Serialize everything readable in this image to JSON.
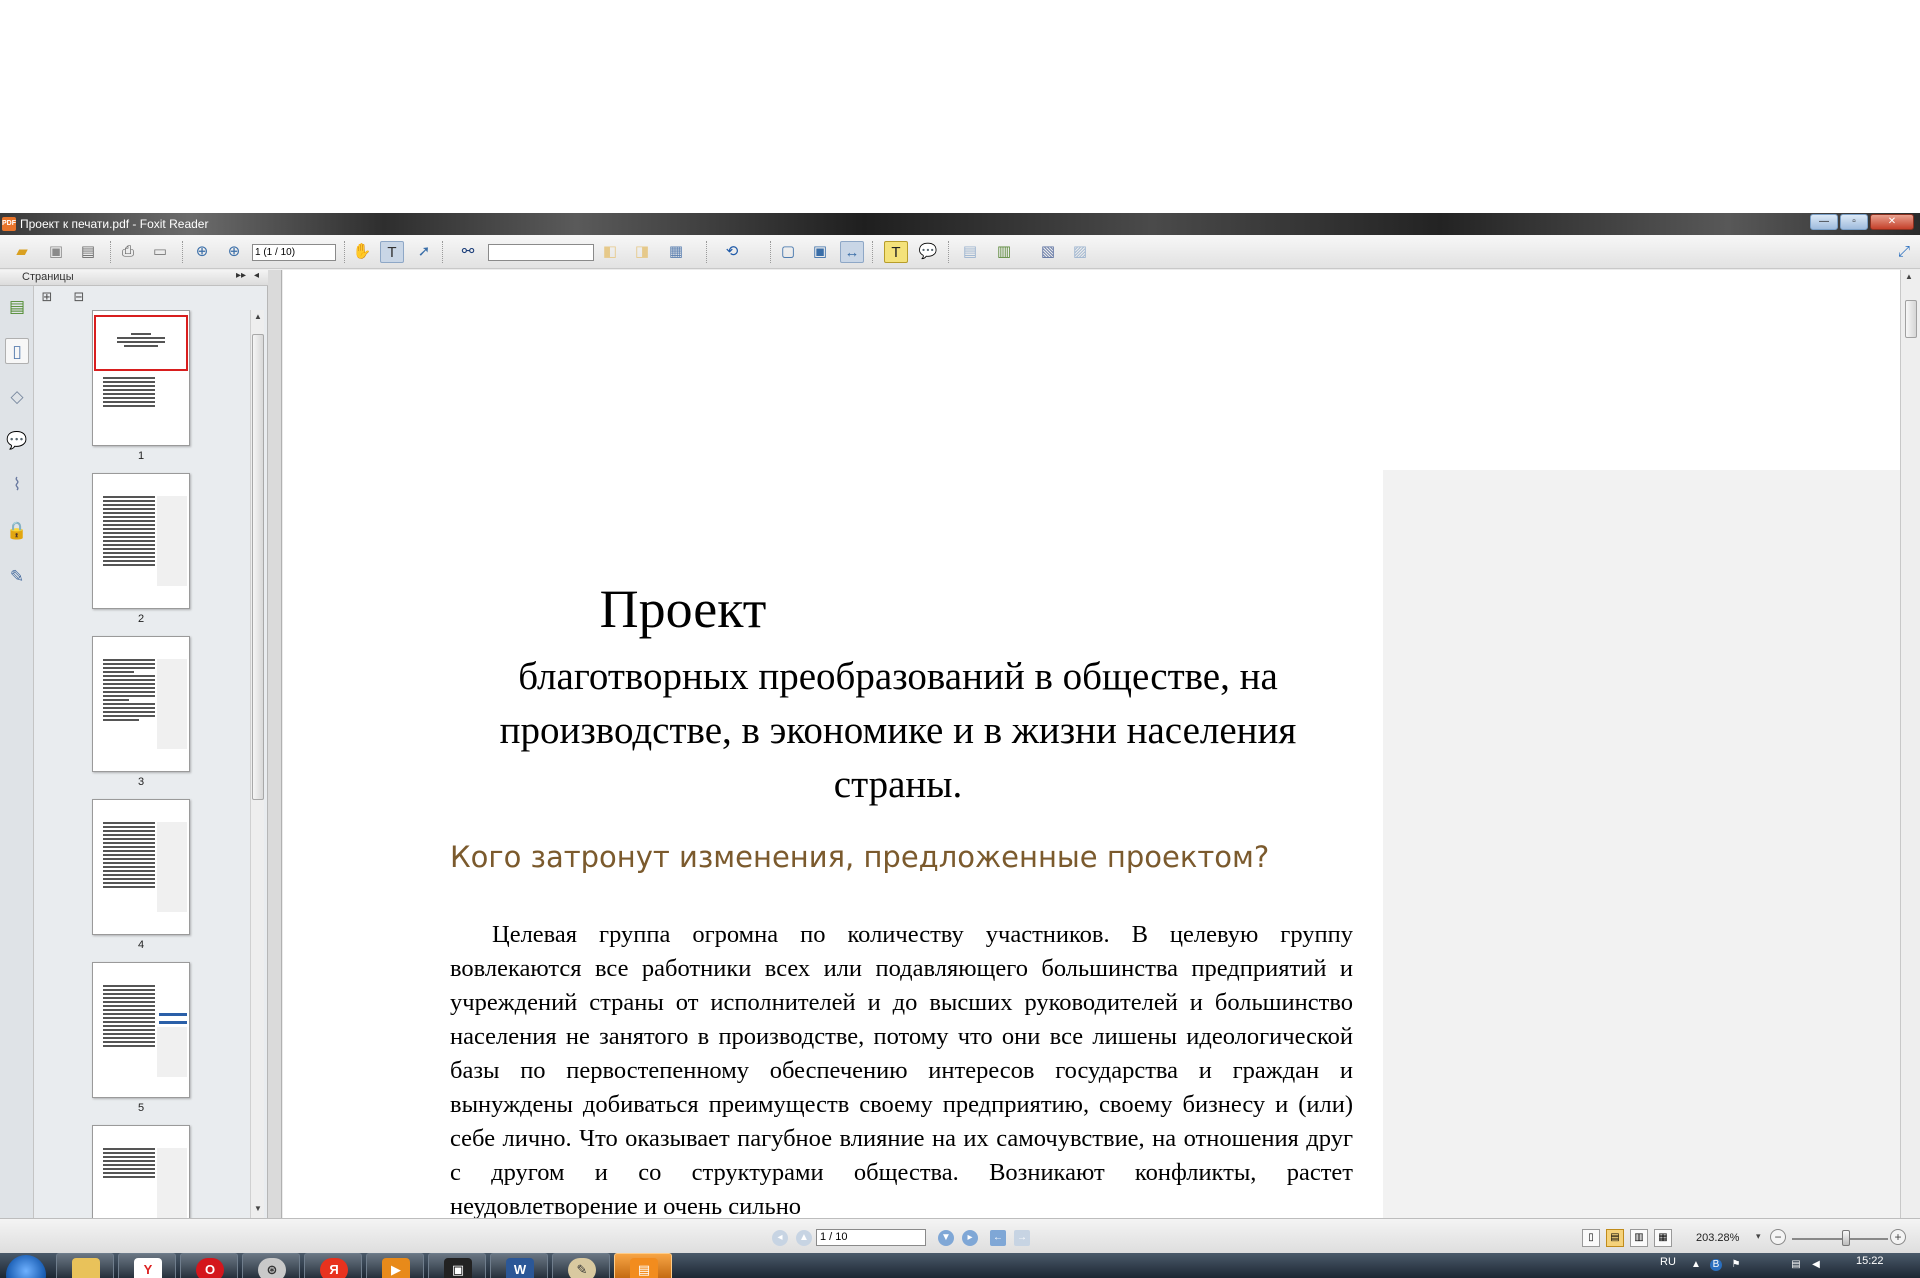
{
  "window": {
    "title": "Проект к печати.pdf - Foxit Reader",
    "app_icon_text": "PDF",
    "buttons": {
      "minimize": "—",
      "maximize": "▫",
      "close": "✕"
    }
  },
  "toolbar": {
    "page_field": "1 (1 / 10)",
    "search_placeholder": ""
  },
  "left_panel": {
    "header": "Страницы",
    "thumbnails": [
      {
        "number": "1"
      },
      {
        "number": "2"
      },
      {
        "number": "3"
      },
      {
        "number": "4"
      },
      {
        "number": "5"
      }
    ]
  },
  "document": {
    "title": "Проект",
    "subtitle": "благотворных преобразований в обществе, на производстве, в экономике и в жизни населения страны.",
    "heading": "Кого затронут изменения, предложенные проектом?",
    "body": "Целевая группа огромна по количеству участников. В целевую группу вовлекаются все работники всех или подавляющего большинства предприятий и учреждений страны от исполнителей и до высших руководителей и большинство населения не занятого в производстве, потому что они все лишены идеологической базы по первостепенному обеспечению интересов государства и граждан и вынуждены добиваться преимуществ своему предприятию, своему бизнесу и (или) себе лично. Что оказывает пагубное влияние на их самочувствие, на отношения друг с другом и со структурами общества. Возникают конфликты, растет неудовлетворение и очень сильно"
  },
  "statusbar": {
    "page_field": "1 / 10",
    "zoom": "203.28%"
  },
  "taskbar": {
    "language": "RU",
    "clock": "15:22"
  },
  "colors": {
    "heading": "#7b5a2d",
    "selection_border": "#d81e1e",
    "accent": "#3a6ea8"
  }
}
